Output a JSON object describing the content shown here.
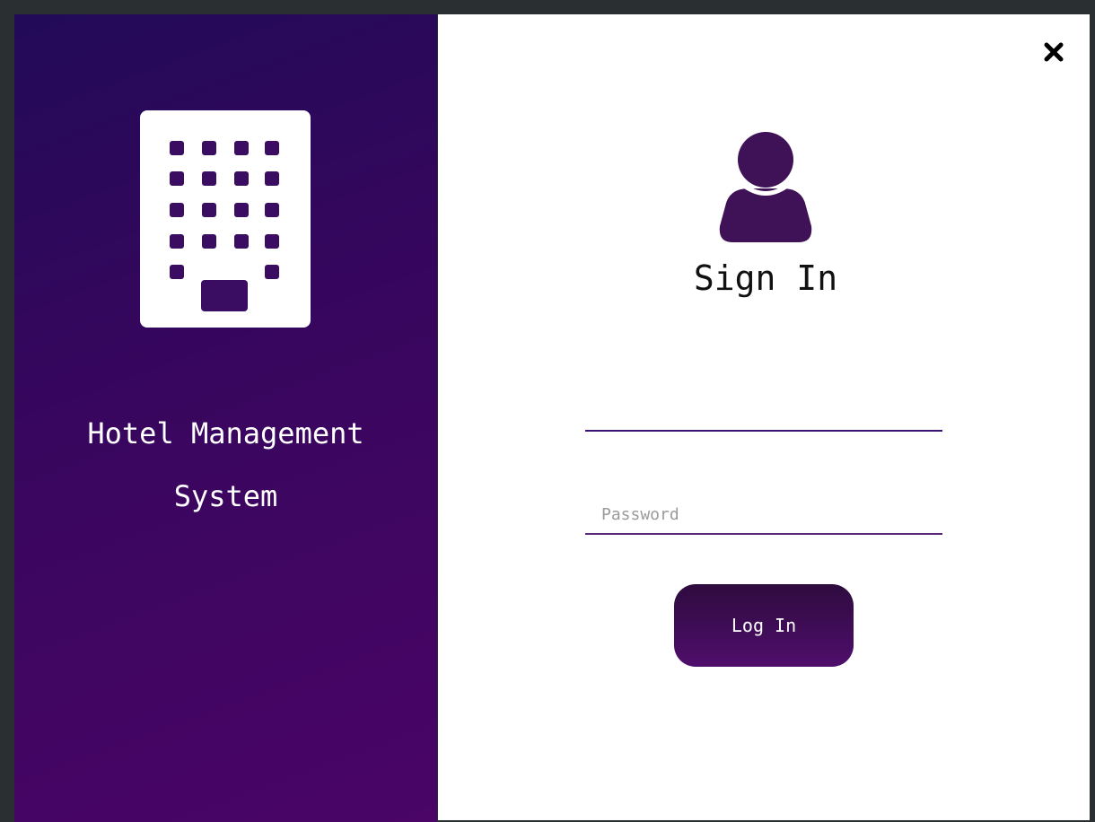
{
  "app": {
    "title": "Hotel Management\nSystem"
  },
  "signin": {
    "title": "Sign In",
    "username_placeholder": "",
    "password_placeholder": "Password",
    "login_label": "Log In",
    "close_label": "×"
  },
  "colors": {
    "panel_gradient_start": "#220a58",
    "panel_gradient_end": "#4a0566",
    "accent": "#3b1273",
    "button": "#4f0e6c",
    "icon": "#3f1258"
  },
  "icons": {
    "building": "building-icon",
    "avatar": "user-icon",
    "close": "close-icon"
  }
}
